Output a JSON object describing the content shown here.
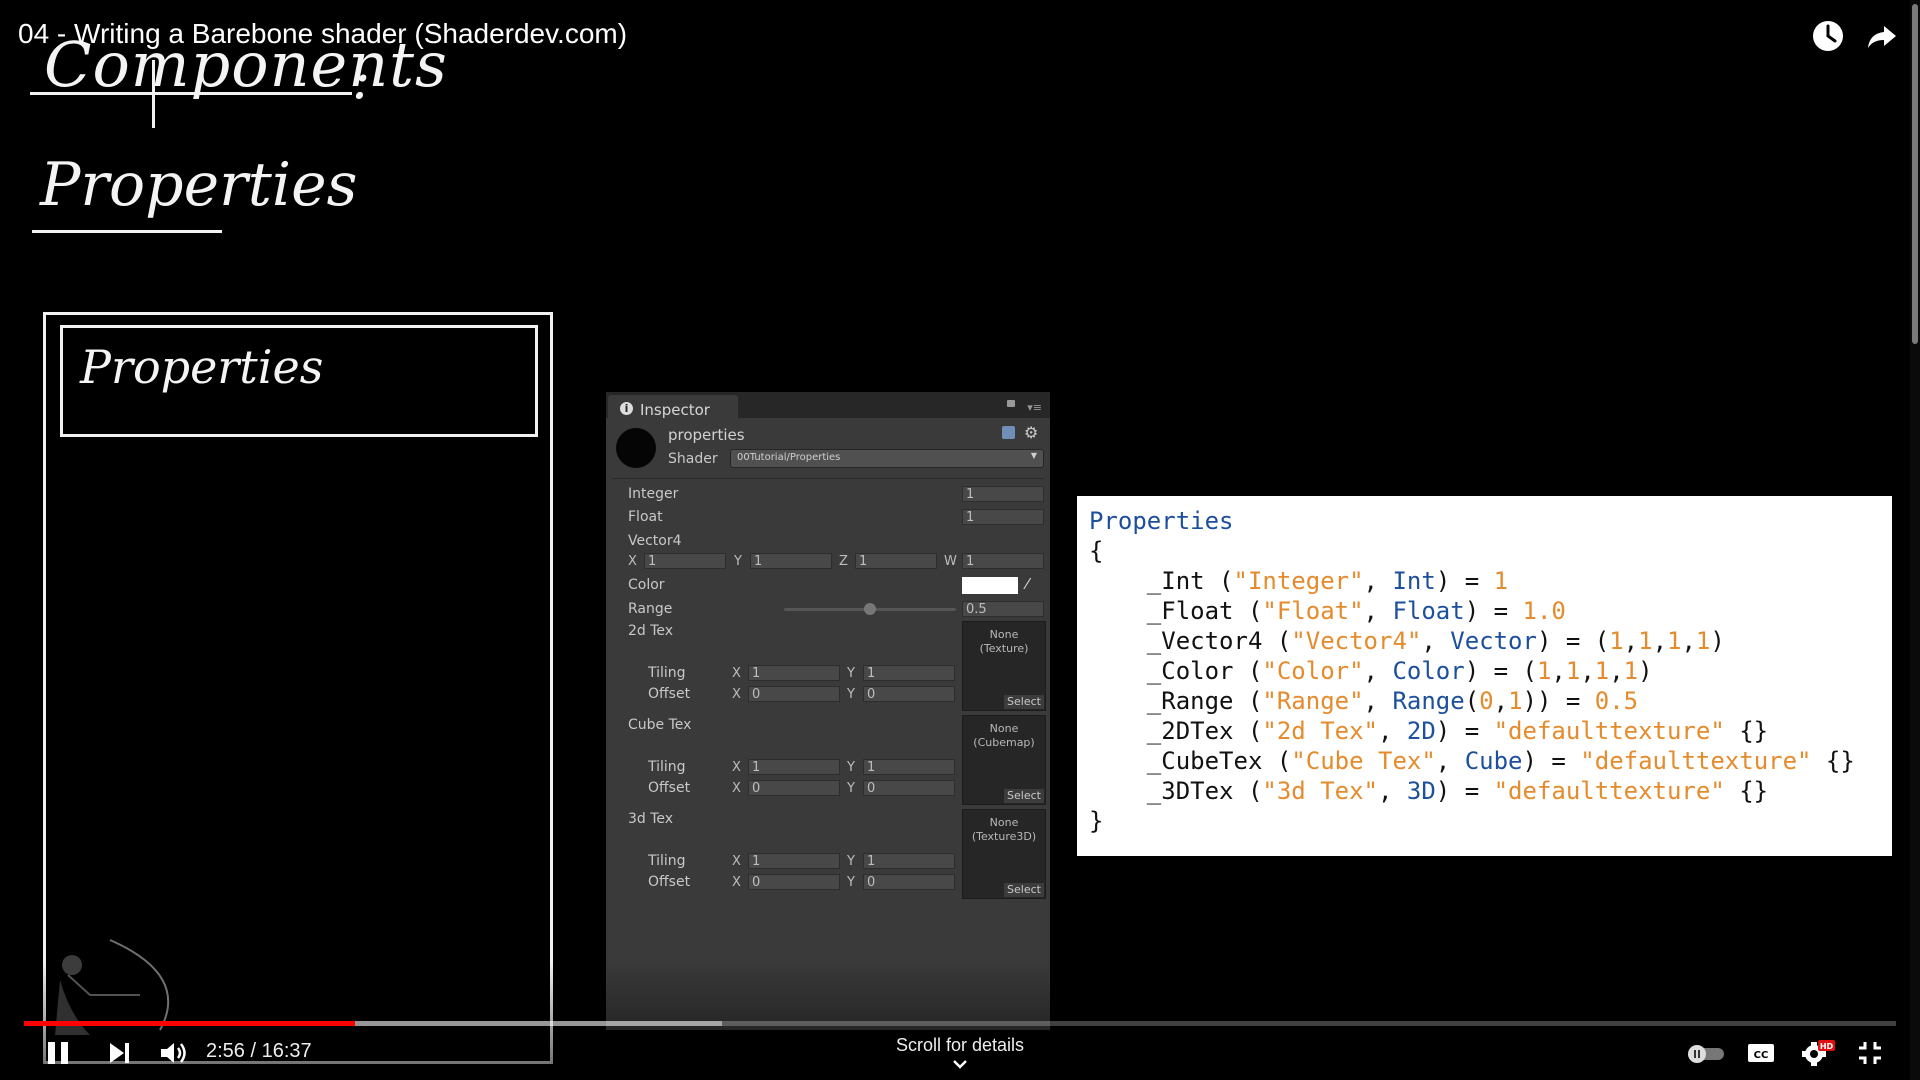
{
  "video": {
    "title": "04 - Writing a Barebone shader (Shaderdev.com)"
  },
  "whiteboard": {
    "heading": "Components",
    "colon": ":",
    "subheading": "Properties",
    "box_label": "Properties"
  },
  "inspector": {
    "tab_label": "Inspector",
    "material_name": "properties",
    "shader_label": "Shader",
    "shader_value": "00Tutorial/Properties",
    "props": {
      "integer": {
        "label": "Integer",
        "value": "1"
      },
      "float": {
        "label": "Float",
        "value": "1"
      },
      "vector4": {
        "label": "Vector4",
        "x_label": "X",
        "x": "1",
        "y_label": "Y",
        "y": "1",
        "z_label": "Z",
        "z": "1",
        "w_label": "W",
        "w": "1"
      },
      "color": {
        "label": "Color",
        "value": "#ffffff"
      },
      "range": {
        "label": "Range",
        "value": "0.5",
        "fraction": 0.5
      },
      "tex2d": {
        "label": "2d Tex",
        "slot_line1": "None",
        "slot_line2": "(Texture)",
        "select": "Select",
        "tiling_label": "Tiling",
        "offset_label": "Offset",
        "x_label": "X",
        "y_label": "Y",
        "tiling_x": "1",
        "tiling_y": "1",
        "offset_x": "0",
        "offset_y": "0"
      },
      "cubetex": {
        "label": "Cube Tex",
        "slot_line1": "None",
        "slot_line2": "(Cubemap)",
        "select": "Select",
        "tiling_label": "Tiling",
        "offset_label": "Offset",
        "x_label": "X",
        "y_label": "Y",
        "tiling_x": "1",
        "tiling_y": "1",
        "offset_x": "0",
        "offset_y": "0"
      },
      "tex3d": {
        "label": "3d Tex",
        "slot_line1": "None",
        "slot_line2": "(Texture3D)",
        "select": "Select",
        "tiling_label": "Tiling",
        "offset_label": "Offset",
        "x_label": "X",
        "y_label": "Y",
        "tiling_x": "1",
        "tiling_y": "1",
        "offset_x": "0",
        "offset_y": "0"
      }
    }
  },
  "code": {
    "lines": [
      [
        {
          "t": "Properties",
          "c": "kw"
        }
      ],
      [
        {
          "t": "{",
          "c": ""
        }
      ],
      [
        {
          "t": "    _Int (",
          "c": ""
        },
        {
          "t": "\"Integer\"",
          "c": "str"
        },
        {
          "t": ", ",
          "c": ""
        },
        {
          "t": "Int",
          "c": "kw"
        },
        {
          "t": ") = ",
          "c": ""
        },
        {
          "t": "1",
          "c": "num"
        }
      ],
      [
        {
          "t": "    _Float (",
          "c": ""
        },
        {
          "t": "\"Float\"",
          "c": "str"
        },
        {
          "t": ", ",
          "c": ""
        },
        {
          "t": "Float",
          "c": "kw"
        },
        {
          "t": ") = ",
          "c": ""
        },
        {
          "t": "1.0",
          "c": "num"
        }
      ],
      [
        {
          "t": "    _Vector4 (",
          "c": ""
        },
        {
          "t": "\"Vector4\"",
          "c": "str"
        },
        {
          "t": ", ",
          "c": ""
        },
        {
          "t": "Vector",
          "c": "kw"
        },
        {
          "t": ") = (",
          "c": ""
        },
        {
          "t": "1",
          "c": "num"
        },
        {
          "t": ",",
          "c": ""
        },
        {
          "t": "1",
          "c": "num"
        },
        {
          "t": ",",
          "c": ""
        },
        {
          "t": "1",
          "c": "num"
        },
        {
          "t": ",",
          "c": ""
        },
        {
          "t": "1",
          "c": "num"
        },
        {
          "t": ")",
          "c": ""
        }
      ],
      [
        {
          "t": "    _Color (",
          "c": ""
        },
        {
          "t": "\"Color\"",
          "c": "str"
        },
        {
          "t": ", ",
          "c": ""
        },
        {
          "t": "Color",
          "c": "kw"
        },
        {
          "t": ") = (",
          "c": ""
        },
        {
          "t": "1",
          "c": "num"
        },
        {
          "t": ",",
          "c": ""
        },
        {
          "t": "1",
          "c": "num"
        },
        {
          "t": ",",
          "c": ""
        },
        {
          "t": "1",
          "c": "num"
        },
        {
          "t": ",",
          "c": ""
        },
        {
          "t": "1",
          "c": "num"
        },
        {
          "t": ")",
          "c": ""
        }
      ],
      [
        {
          "t": "    _Range (",
          "c": ""
        },
        {
          "t": "\"Range\"",
          "c": "str"
        },
        {
          "t": ", ",
          "c": ""
        },
        {
          "t": "Range",
          "c": "kw"
        },
        {
          "t": "(",
          "c": ""
        },
        {
          "t": "0",
          "c": "num"
        },
        {
          "t": ",",
          "c": ""
        },
        {
          "t": "1",
          "c": "num"
        },
        {
          "t": ")) = ",
          "c": ""
        },
        {
          "t": "0.5",
          "c": "num"
        }
      ],
      [
        {
          "t": "    _2DTex (",
          "c": ""
        },
        {
          "t": "\"2d Tex\"",
          "c": "str"
        },
        {
          "t": ", ",
          "c": ""
        },
        {
          "t": "2D",
          "c": "kw"
        },
        {
          "t": ") = ",
          "c": ""
        },
        {
          "t": "\"defaulttexture\"",
          "c": "str"
        },
        {
          "t": " {}",
          "c": ""
        }
      ],
      [
        {
          "t": "    _CubeTex (",
          "c": ""
        },
        {
          "t": "\"Cube Tex\"",
          "c": "str"
        },
        {
          "t": ", ",
          "c": ""
        },
        {
          "t": "Cube",
          "c": "kw"
        },
        {
          "t": ") = ",
          "c": ""
        },
        {
          "t": "\"defaulttexture\"",
          "c": "str"
        },
        {
          "t": " {}",
          "c": ""
        }
      ],
      [
        {
          "t": "    _3DTex (",
          "c": ""
        },
        {
          "t": "\"3d Tex\"",
          "c": "str"
        },
        {
          "t": ", ",
          "c": ""
        },
        {
          "t": "3D",
          "c": "kw"
        },
        {
          "t": ") = ",
          "c": ""
        },
        {
          "t": "\"defaulttexture\"",
          "c": "str"
        },
        {
          "t": " {}",
          "c": ""
        }
      ],
      [
        {
          "t": "}",
          "c": ""
        }
      ]
    ]
  },
  "player": {
    "time_current": "2:56",
    "time_total": "16:37",
    "time_text": "2:56 / 16:37",
    "played_fraction": 0.1766,
    "buffered_fraction": 0.3728,
    "scroll_hint": "Scroll for details",
    "hd_badge": "HD",
    "icons": [
      "pause-icon",
      "next-icon",
      "volume-icon",
      "autoplay-toggle-icon",
      "captions-icon",
      "settings-icon",
      "exit-fullscreen-icon",
      "watch-later-icon",
      "share-icon"
    ]
  }
}
